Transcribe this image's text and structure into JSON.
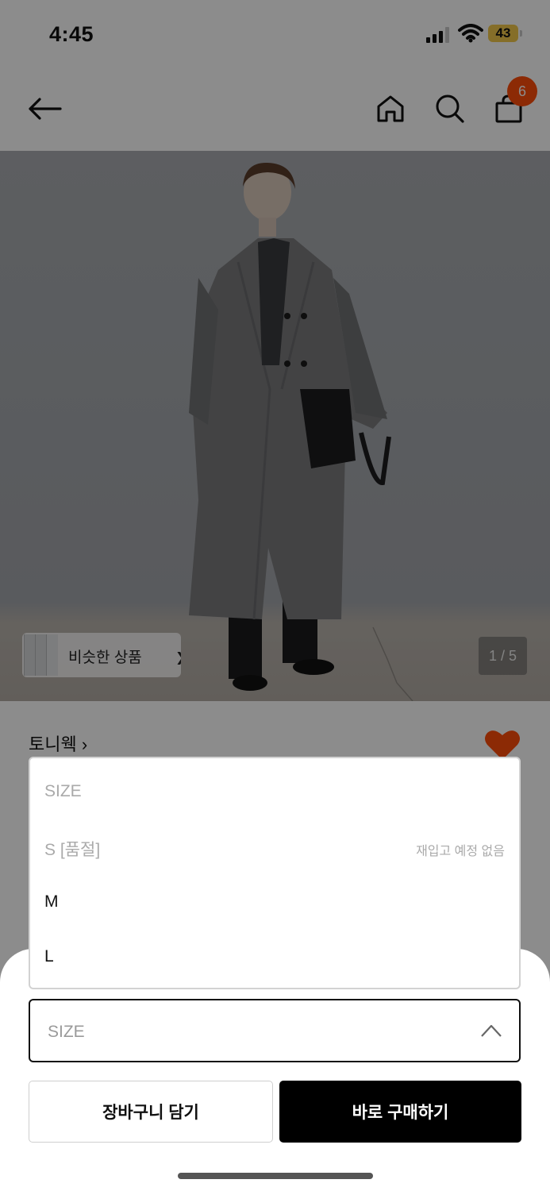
{
  "status_bar": {
    "time": "4:45",
    "battery": "43"
  },
  "nav": {
    "cart_count": "6",
    "icons": [
      "back-arrow-icon",
      "home-icon",
      "search-icon",
      "shopping-bag-icon"
    ]
  },
  "hero": {
    "similar_label": "비슷한 상품",
    "page_indicator": "1 / 5"
  },
  "product": {
    "brand": "토니웩 ›",
    "liked": true
  },
  "size_dropdown": {
    "options": [
      {
        "label": "SIZE",
        "note": "",
        "disabled": true
      },
      {
        "label": "S [품절]",
        "note": "재입고 예정 없음",
        "disabled": true
      },
      {
        "label": "M",
        "note": "",
        "disabled": false
      },
      {
        "label": "L",
        "note": "",
        "disabled": false
      }
    ]
  },
  "size_select": {
    "label": "SIZE"
  },
  "actions": {
    "add_to_cart": "장바구니 담기",
    "buy_now": "바로 구매하기"
  },
  "colors": {
    "badge": "#ff4d0a",
    "heart": "#ff4d0a",
    "primary_button": "#000000"
  }
}
